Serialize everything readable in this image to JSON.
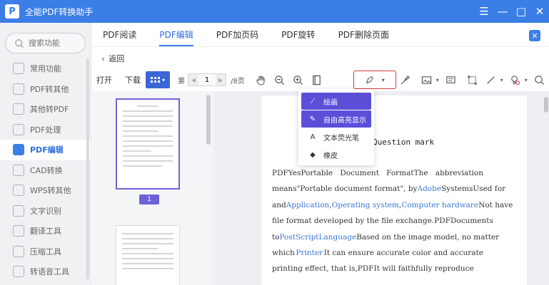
{
  "app": {
    "title": "全能PDF转换助手",
    "logo_letter": "P"
  },
  "window_controls": {
    "menu": "☰",
    "minimize": "—",
    "maximize": "□",
    "close": "✕"
  },
  "sidebar": {
    "search_placeholder": "搜索功能",
    "items": [
      {
        "label": "常用功能",
        "active": false
      },
      {
        "label": "PDF转其他",
        "active": false
      },
      {
        "label": "其他转PDF",
        "active": false
      },
      {
        "label": "PDF处理",
        "active": false
      },
      {
        "label": "PDF编辑",
        "active": true
      },
      {
        "label": "CAD转换",
        "active": false
      },
      {
        "label": "WPS转其他",
        "active": false
      },
      {
        "label": "文字识别",
        "active": false
      },
      {
        "label": "翻译工具",
        "active": false
      },
      {
        "label": "压缩工具",
        "active": false
      },
      {
        "label": "转语音工具",
        "active": false
      }
    ]
  },
  "tabs": [
    {
      "label": "PDF阅读",
      "active": false
    },
    {
      "label": "PDF编辑",
      "active": true
    },
    {
      "label": "PDF加页码",
      "active": false
    },
    {
      "label": "PDF旋转",
      "active": false
    },
    {
      "label": "PDF删除页面",
      "active": false
    }
  ],
  "back_label": "返回",
  "toolbar": {
    "open_label": "打开",
    "download_label": "下载",
    "page_prefix": "第",
    "current_page": "1",
    "total_pages": "/8页"
  },
  "thumbnail": {
    "page_number": "1"
  },
  "dropdown": {
    "items": [
      {
        "label": "绘画",
        "icon": "pen-icon",
        "glyph": "⟋",
        "highlighted": true
      },
      {
        "label": "自由高亮显示",
        "icon": "highlighter-icon",
        "glyph": "✎",
        "highlighted": true
      },
      {
        "label": "文本荧光笔",
        "icon": "text-highlight-icon",
        "glyph": "A",
        "highlighted": false
      },
      {
        "label": "橡皮",
        "icon": "eraser-icon",
        "glyph": "◆",
        "highlighted": false
      }
    ]
  },
  "document": {
    "heading": "Question mark",
    "lines": [
      [
        {
          "t": "PDFYesPortable"
        },
        {
          "t": "Document"
        },
        {
          "t": "FormatThe"
        },
        {
          "t": "abbreviation"
        }
      ],
      [
        {
          "t": "means\"Portable document format\", by"
        },
        {
          "t": "Adobe",
          "link": true
        },
        {
          "t": "SystemsUsed for"
        }
      ],
      [
        {
          "t": "and"
        },
        {
          "t": "Application",
          "link": true
        },
        {
          "t": ","
        },
        {
          "t": "Operating system",
          "link": true
        },
        {
          "t": ","
        },
        {
          "t": "Computer hardware",
          "link": true
        },
        {
          "t": "Not have"
        }
      ],
      [
        {
          "t": "file format developed by the file exchange.PDFDocuments"
        }
      ],
      [
        {
          "t": "to"
        },
        {
          "t": "PostScriptLanguage",
          "link": true
        },
        {
          "t": "Based on the image model, no matter"
        }
      ],
      [
        {
          "t": "which"
        },
        {
          "t": "Printer",
          "link": true
        },
        {
          "t": "It can ensure accurate color and accurate"
        }
      ],
      [
        {
          "t": "printing effect, that is,PDFIt will faithfully reproduce"
        }
      ]
    ]
  },
  "colors": {
    "brand": "#3b7ee6",
    "accent": "#5b4fd8",
    "link": "#3a78d6",
    "draw_border": "#d23b3b"
  }
}
